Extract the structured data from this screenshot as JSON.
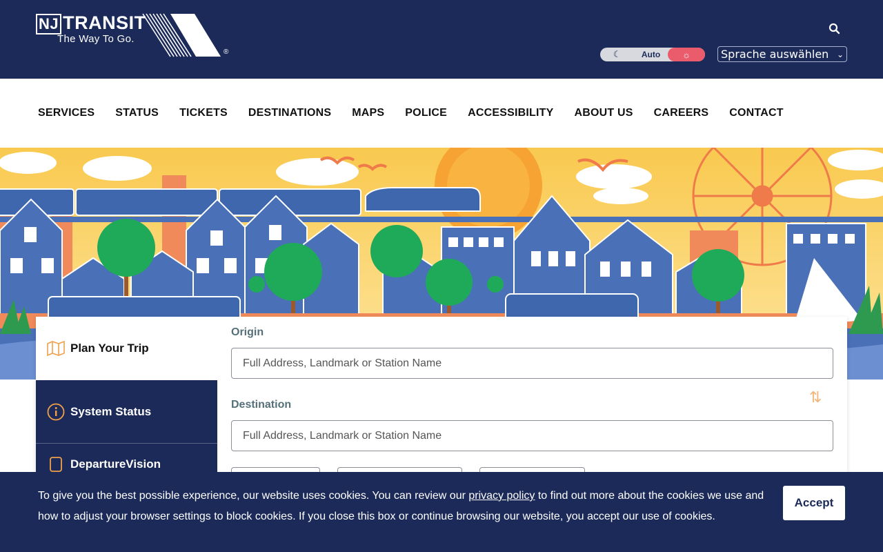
{
  "header": {
    "logo_text": "TRANSIT",
    "logo_nj": "NJ",
    "tagline": "The Way To Go.",
    "registered": "®",
    "mode_toggle": {
      "dark_icon": "moon-icon",
      "auto_label": "Auto",
      "light_icon": "sun-icon"
    },
    "language": {
      "selected": "Sprache auswählen"
    }
  },
  "nav": {
    "items": [
      {
        "label": "SERVICES"
      },
      {
        "label": "STATUS"
      },
      {
        "label": "TICKETS"
      },
      {
        "label": "DESTINATIONS"
      },
      {
        "label": "MAPS"
      },
      {
        "label": "POLICE"
      },
      {
        "label": "ACCESSIBILITY"
      },
      {
        "label": "ABOUT US"
      },
      {
        "label": "CAREERS"
      },
      {
        "label": "CONTACT"
      }
    ]
  },
  "planner": {
    "tabs": [
      {
        "label": "Plan Your Trip",
        "icon": "map-icon"
      },
      {
        "label": "System Status",
        "icon": "info-icon"
      },
      {
        "label": "DepartureVision",
        "icon": "device-icon"
      }
    ],
    "origin_label": "Origin",
    "origin_placeholder": "Full Address, Landmark or Station Name",
    "destination_label": "Destination",
    "destination_placeholder": "Full Address, Landmark or Station Name"
  },
  "cookie": {
    "text_before": "To give you the best possible experience, our website uses cookies. You can review our ",
    "link": "privacy policy",
    "text_after": " to find out more about the cookies we use and how to adjust your browser settings to block cookies. If you close this box or continue browsing our website, you accept our use of cookies.",
    "accept_label": "Accept"
  },
  "colors": {
    "navy": "#1b2a59",
    "accent_orange": "#f0a04b",
    "toggle_active": "#ea5b6b",
    "sky": "#fbd25d",
    "house_blue": "#4a70b8"
  }
}
